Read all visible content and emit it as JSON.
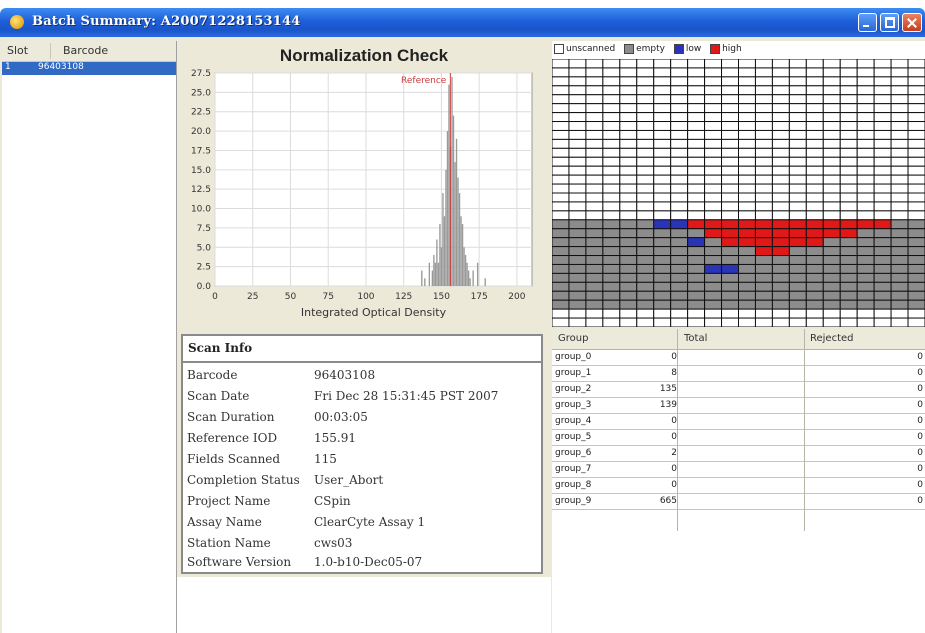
{
  "window": {
    "title": "Batch Summary: A20071228153144"
  },
  "slot_panel": {
    "headers": [
      "Slot",
      "Barcode"
    ],
    "rows": [
      {
        "slot": "1",
        "barcode": "96403108"
      }
    ]
  },
  "chart": {
    "title": "Normalization Check"
  },
  "chart_data": {
    "type": "bar",
    "title": "Normalization Check",
    "xlabel": "Integrated Optical Density",
    "ylabel": "",
    "xlim": [
      0,
      210
    ],
    "ylim": [
      0,
      27.5
    ],
    "x_ticks": [
      "0",
      "25",
      "50",
      "75",
      "100",
      "125",
      "150",
      "175",
      "200"
    ],
    "y_ticks": [
      "0.0",
      "2.5",
      "5.0",
      "7.5",
      "10.0",
      "12.5",
      "15.0",
      "17.5",
      "20.0",
      "22.5",
      "25.0",
      "27.5"
    ],
    "grid": true,
    "reference": {
      "label": "Reference",
      "x": 155.91
    },
    "x": [
      137,
      139,
      142,
      144,
      145,
      146,
      147,
      148,
      149,
      150,
      151,
      152,
      153,
      154,
      155,
      156,
      157,
      158,
      159,
      160,
      161,
      162,
      163,
      164,
      165,
      166,
      167,
      168,
      169,
      171,
      174,
      179
    ],
    "values": [
      2,
      1,
      3,
      2,
      4,
      3,
      6,
      3,
      8,
      5,
      12,
      9,
      15,
      20,
      26,
      18,
      27,
      22,
      16,
      19,
      14,
      12,
      9,
      8,
      5,
      4,
      3,
      2,
      1,
      2,
      3,
      1
    ]
  },
  "scan_info": {
    "header": "Scan Info",
    "rows": [
      {
        "key": "Barcode",
        "value": "96403108"
      },
      {
        "key": "Scan Date",
        "value": "Fri Dec 28 15:31:45 PST 2007"
      },
      {
        "key": "Scan Duration",
        "value": "00:03:05"
      },
      {
        "key": "Reference IOD",
        "value": "155.91"
      },
      {
        "key": "Fields Scanned",
        "value": "115"
      },
      {
        "key": "Completion Status",
        "value": "User_Abort"
      },
      {
        "key": "Project Name",
        "value": "CSpin"
      },
      {
        "key": "Assay Name",
        "value": "ClearCyte Assay 1"
      },
      {
        "key": "Station Name",
        "value": "cws03"
      },
      {
        "key": "Software Version",
        "value": "1.0-b10-Dec05-07"
      }
    ]
  },
  "plate": {
    "legend": [
      {
        "label": "unscanned",
        "color": "#ffffff"
      },
      {
        "label": "empty",
        "color": "#8c8c8c"
      },
      {
        "label": "low",
        "color": "#2a34b8"
      },
      {
        "label": "high",
        "color": "#e01818"
      }
    ],
    "colors": {
      "unscanned": "#ffffff",
      "empty": "#8c8c8c",
      "low": "#2a34b8",
      "high": "#e01818"
    },
    "grid_rows": 30,
    "grid_cols": 22,
    "low_cells": [
      [
        18,
        6
      ],
      [
        18,
        7
      ],
      [
        20,
        8
      ],
      [
        23,
        9
      ],
      [
        23,
        10
      ]
    ],
    "high_cells": [
      [
        18,
        8
      ],
      [
        18,
        9
      ],
      [
        18,
        10
      ],
      [
        18,
        11
      ],
      [
        18,
        12
      ],
      [
        18,
        13
      ],
      [
        18,
        14
      ],
      [
        18,
        15
      ],
      [
        18,
        16
      ],
      [
        18,
        17
      ],
      [
        18,
        18
      ],
      [
        18,
        19
      ],
      [
        19,
        9
      ],
      [
        19,
        10
      ],
      [
        19,
        11
      ],
      [
        19,
        12
      ],
      [
        19,
        13
      ],
      [
        19,
        14
      ],
      [
        19,
        15
      ],
      [
        19,
        16
      ],
      [
        19,
        17
      ],
      [
        20,
        10
      ],
      [
        20,
        11
      ],
      [
        20,
        12
      ],
      [
        20,
        13
      ],
      [
        20,
        14
      ],
      [
        20,
        15
      ],
      [
        21,
        12
      ],
      [
        21,
        13
      ]
    ]
  },
  "group_table": {
    "headers": [
      "Group",
      "Total",
      "Rejected"
    ],
    "rows": [
      {
        "group": "group_0",
        "total": "0",
        "rejected": "0"
      },
      {
        "group": "group_1",
        "total": "8",
        "rejected": "0"
      },
      {
        "group": "group_2",
        "total": "135",
        "rejected": "0"
      },
      {
        "group": "group_3",
        "total": "139",
        "rejected": "0"
      },
      {
        "group": "group_4",
        "total": "0",
        "rejected": "0"
      },
      {
        "group": "group_5",
        "total": "0",
        "rejected": "0"
      },
      {
        "group": "group_6",
        "total": "2",
        "rejected": "0"
      },
      {
        "group": "group_7",
        "total": "0",
        "rejected": "0"
      },
      {
        "group": "group_8",
        "total": "0",
        "rejected": "0"
      },
      {
        "group": "group_9",
        "total": "665",
        "rejected": "0"
      }
    ]
  }
}
